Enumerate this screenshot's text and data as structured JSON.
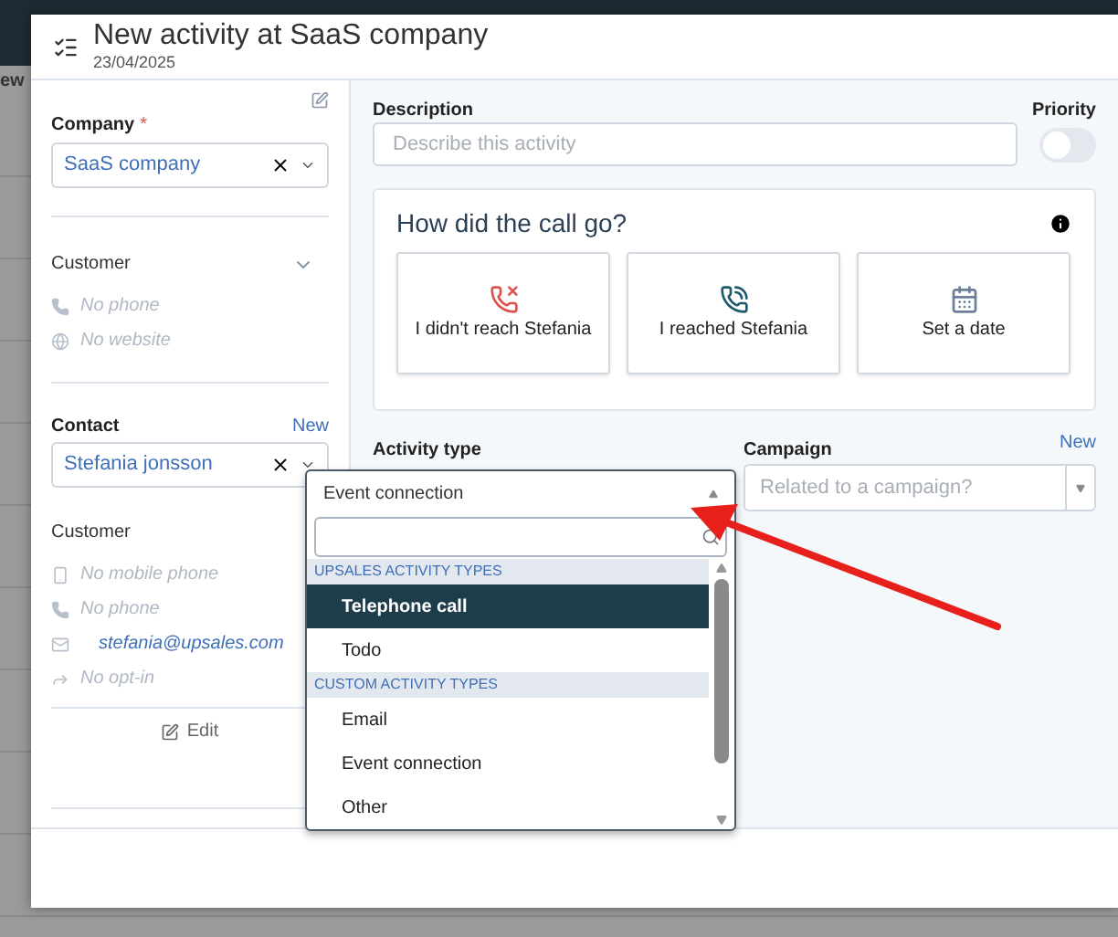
{
  "background": {
    "text_fragment": "ew"
  },
  "modal": {
    "title": "New activity at SaaS company",
    "date": "23/04/2025"
  },
  "company": {
    "label": "Company",
    "required_mark": "*",
    "value": "SaaS company"
  },
  "company_info": {
    "title": "Customer",
    "lines": [
      {
        "kind": "phone",
        "text": "No phone",
        "empty": true
      },
      {
        "kind": "website",
        "text": "No website",
        "empty": true
      }
    ]
  },
  "contact": {
    "label": "Contact",
    "new_link": "New",
    "value": "Stefania jonsson"
  },
  "contact_info": {
    "title": "Customer",
    "lines": [
      {
        "kind": "mobile",
        "text": "No mobile phone",
        "empty": true
      },
      {
        "kind": "phone",
        "text": "No phone",
        "empty": true
      },
      {
        "kind": "email",
        "text": "stefania@upsales.com",
        "empty": false
      },
      {
        "kind": "optin",
        "text": "No opt-in",
        "empty": true
      }
    ]
  },
  "edit_button": "Edit",
  "description": {
    "label": "Description",
    "placeholder": "Describe this activity"
  },
  "priority": {
    "label": "Priority",
    "on": false
  },
  "call_outcome": {
    "title": "How did the call go?",
    "options": [
      {
        "kind": "missed",
        "label": "I didn't reach Stefania"
      },
      {
        "kind": "reached",
        "label": "I reached Stefania"
      },
      {
        "kind": "date",
        "label": "Set a date"
      }
    ]
  },
  "activity_type": {
    "label": "Activity type",
    "value": "Event connection",
    "expanded": true,
    "groups": [
      {
        "title": "UPSALES ACTIVITY TYPES",
        "items": [
          {
            "label": "Telephone call",
            "selected": true
          },
          {
            "label": "Todo",
            "selected": false
          }
        ]
      },
      {
        "title": "CUSTOM ACTIVITY TYPES",
        "items": [
          {
            "label": "Email",
            "selected": false
          },
          {
            "label": "Event connection",
            "selected": false
          },
          {
            "label": "Other",
            "selected": false
          }
        ]
      }
    ]
  },
  "campaign": {
    "label": "Campaign",
    "new_link": "New",
    "placeholder": "Related to a campaign?"
  }
}
